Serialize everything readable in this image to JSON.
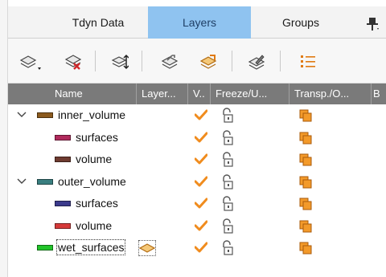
{
  "tabs": [
    {
      "label": "Tdyn Data",
      "active": false
    },
    {
      "label": "Layers",
      "active": true
    },
    {
      "label": "Groups",
      "active": false
    }
  ],
  "toolbar": {
    "icons": [
      "new-layer-icon",
      "delete-layer-icon",
      "move-layer-icon",
      "layer-settings-icon",
      "layer-on-icon",
      "rename-layer-icon",
      "list-icon"
    ]
  },
  "columns": {
    "name": "Name",
    "layer": "Layer...",
    "visible": "V..",
    "freeze": "Freeze/U...",
    "transparency": "Transp./O...",
    "b": "B"
  },
  "layers": [
    {
      "label": "inner_volume",
      "level": 0,
      "expandable": true,
      "swatch_color": "#8b5a1e"
    },
    {
      "label": "surfaces",
      "level": 1,
      "expandable": false,
      "swatch_color": "#b02a5c"
    },
    {
      "label": "volume",
      "level": 1,
      "expandable": false,
      "swatch_color": "#6e3b30"
    },
    {
      "label": "outer_volume",
      "level": 0,
      "expandable": true,
      "swatch_color": "#3a7f80"
    },
    {
      "label": "surfaces",
      "level": 1,
      "expandable": false,
      "swatch_color": "#3b3a8c"
    },
    {
      "label": "volume",
      "level": 1,
      "expandable": false,
      "swatch_color": "#d63a3a"
    },
    {
      "label": "wet_surfaces",
      "level": 0,
      "expandable": false,
      "swatch_color": "#22c42a",
      "selected": true
    }
  ],
  "colors": {
    "active_tab": "#8fc3f0",
    "header_bg": "#7a7a7a",
    "check": "#f08c1e",
    "transparency": "#f39a2a"
  }
}
